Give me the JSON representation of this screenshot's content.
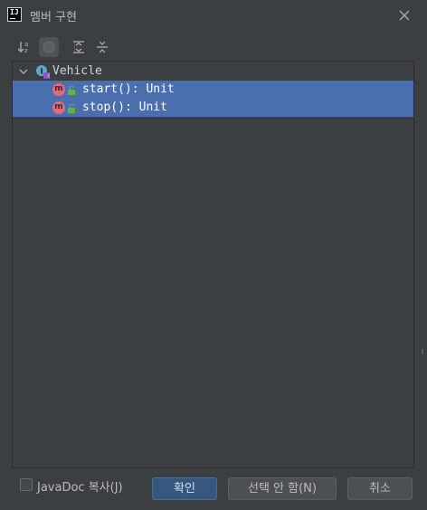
{
  "window": {
    "title": "멤버 구현",
    "app_icon_text": "IJ"
  },
  "toolbar": {
    "sort_icon": "sort-alphabetically-icon",
    "toggle_icon": "circle-toggle-icon",
    "expand_icon": "expand-all-icon",
    "collapse_icon": "collapse-all-icon"
  },
  "tree": {
    "root": {
      "label": "Vehicle",
      "icon": "kotlin-interface-icon"
    },
    "items": [
      {
        "label": "start(): Unit",
        "icon": "method-icon",
        "selected": true
      },
      {
        "label": "stop(): Unit",
        "icon": "method-icon",
        "selected": true
      }
    ]
  },
  "footer": {
    "javadoc_label": "JavaDoc 복사(J)",
    "javadoc_checked": false,
    "ok_label": "확인",
    "select_none_label": "선택 안 함(N)",
    "cancel_label": "취소"
  },
  "colors": {
    "background": "#3c3f41",
    "selection": "#4b6eaf",
    "primary_button": "#365880",
    "method_badge": "#e16a7a"
  }
}
